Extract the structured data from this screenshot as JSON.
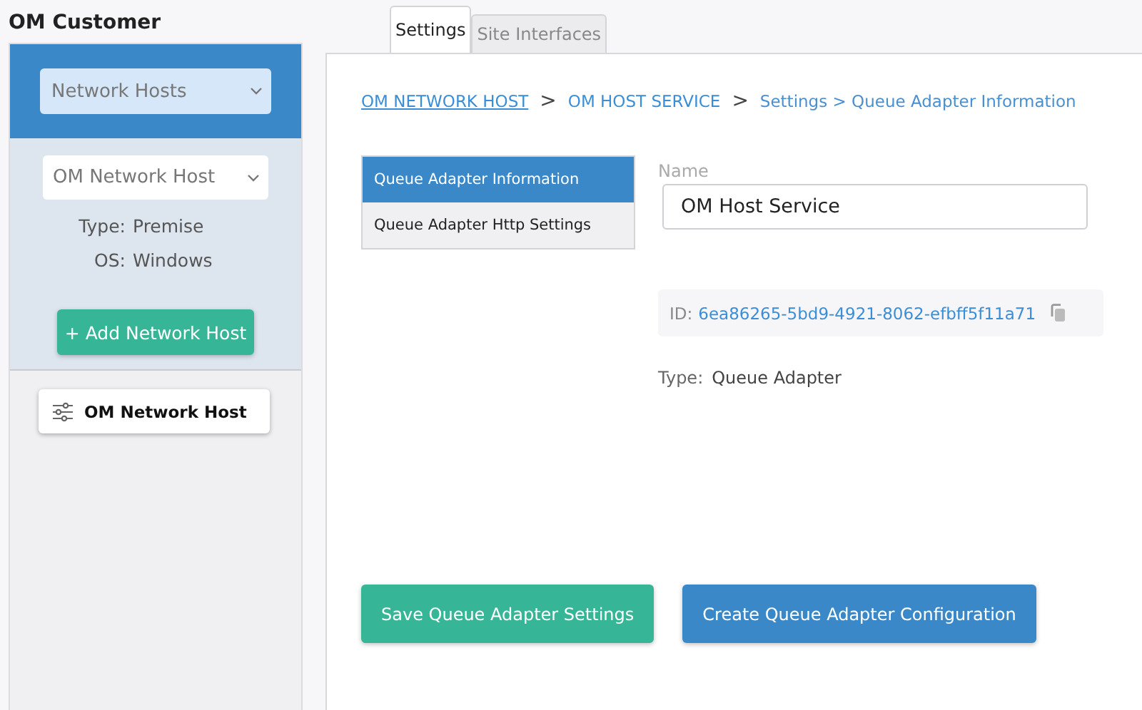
{
  "customer": {
    "title": "OM Customer"
  },
  "sidebar": {
    "category_select": {
      "value": "Network Hosts"
    },
    "host_select": {
      "value": "OM Network Host"
    },
    "details": [
      {
        "label": "Type:",
        "value": "Premise"
      },
      {
        "label": "OS:",
        "value": "Windows"
      }
    ],
    "add_button": "+ Add Network Host",
    "hosts": [
      {
        "label": "OM Network Host",
        "selected": true
      }
    ]
  },
  "tabs": [
    {
      "label": "Settings",
      "selected": true
    },
    {
      "label": "Site Interfaces",
      "selected": false
    }
  ],
  "breadcrumb": [
    {
      "kind": "link",
      "text": "OM NETWORK HOST",
      "underlined": true
    },
    {
      "kind": "separator",
      "text": ">"
    },
    {
      "kind": "link",
      "text": "OM HOST SERVICE",
      "underlined": false
    },
    {
      "kind": "separator",
      "text": ">"
    },
    {
      "kind": "current",
      "text": "Settings > Queue Adapter Information"
    }
  ],
  "menu": [
    {
      "label": "Queue Adapter Information",
      "selected": true
    },
    {
      "label": "Queue Adapter Http Settings",
      "selected": false
    }
  ],
  "name_field": {
    "label": "Name",
    "value": "OM Host Service"
  },
  "id": {
    "label": "ID:",
    "value": "6ea86265-5bd9-4921-8062-efbff5f11a71"
  },
  "type": {
    "label": "Type:",
    "value": "Queue Adapter"
  },
  "buttons": [
    {
      "kind": "save",
      "label": "Save Queue Adapter Settings"
    },
    {
      "kind": "create",
      "label": "Create Queue Adapter Configuration"
    }
  ]
}
